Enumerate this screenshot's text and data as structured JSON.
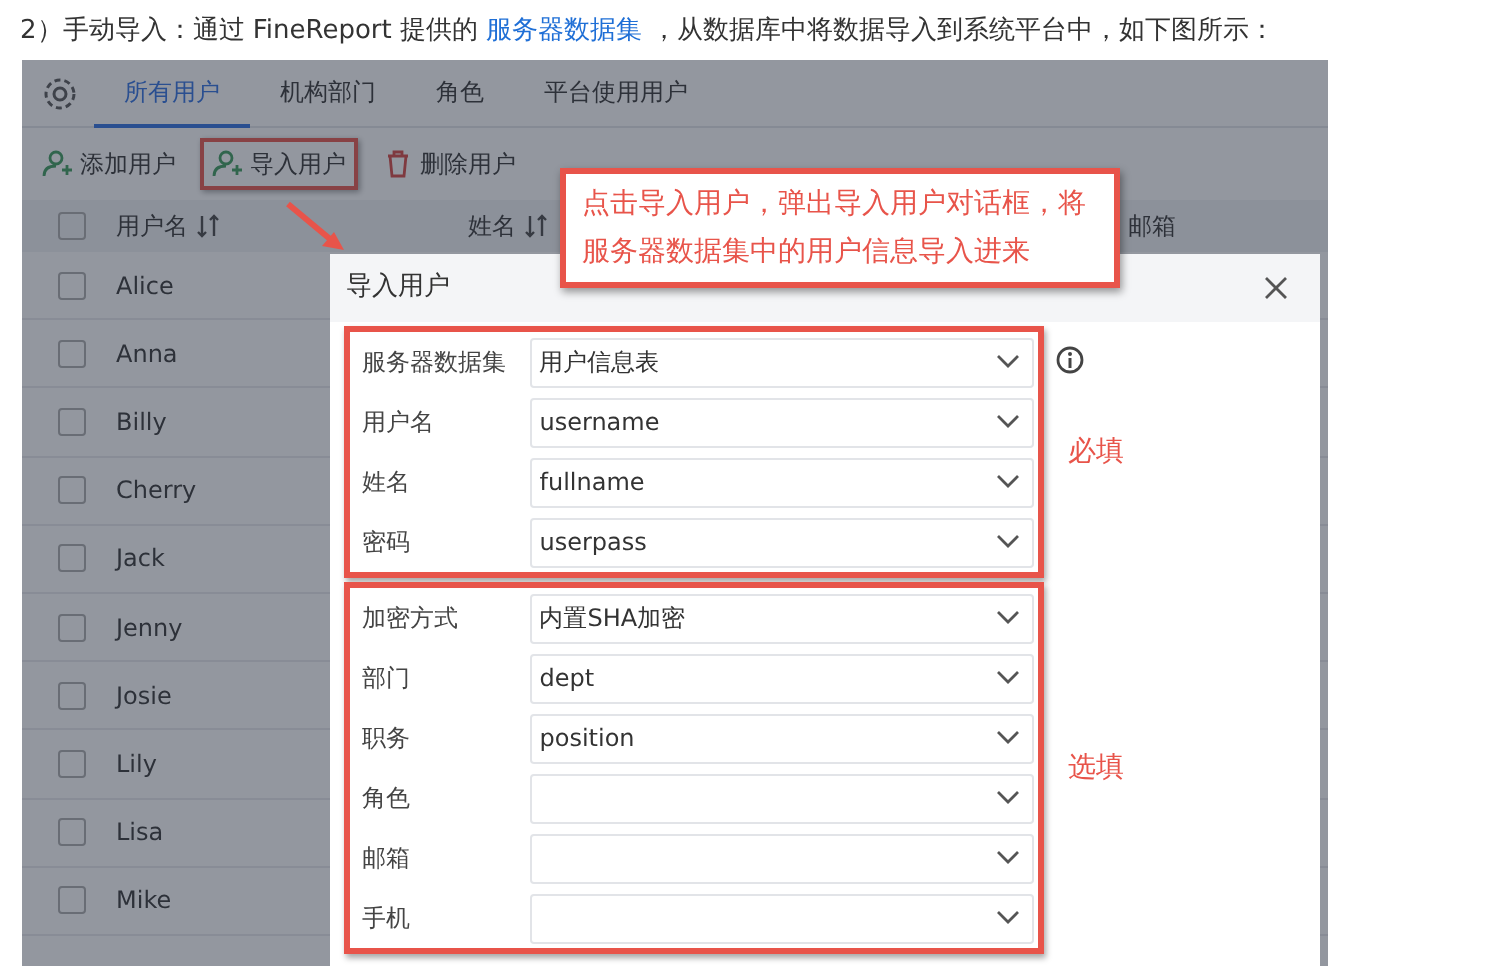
{
  "intro": {
    "text": "2）手动导入：通过 FineReport 提供的 ",
    "link": "服务器数据集",
    "text_after": " ，从数据库中将数据导入到系统平台中，如下图所示："
  },
  "app": {
    "tabs": [
      {
        "label": "所有用户",
        "selected": true
      },
      {
        "label": "机构部门",
        "selected": false
      },
      {
        "label": "角色",
        "selected": false
      },
      {
        "label": "平台使用用户",
        "selected": false
      }
    ],
    "toolbar": [
      {
        "label": "添加用户",
        "kind": "add",
        "annotated": false
      },
      {
        "label": "导入用户",
        "kind": "import",
        "annotated": true
      },
      {
        "label": "删除用户",
        "kind": "delete",
        "annotated": false
      }
    ],
    "table": {
      "header_checked": false,
      "columns": [
        "用户名",
        "姓名",
        "邮箱"
      ],
      "rows": [
        {
          "name": "Alice",
          "checked": false
        },
        {
          "name": "Anna",
          "checked": false
        },
        {
          "name": "Billy",
          "checked": false
        },
        {
          "name": "Cherry",
          "checked": false
        },
        {
          "name": "Jack",
          "checked": false
        },
        {
          "name": "Jenny",
          "checked": false
        },
        {
          "name": "Josie",
          "checked": false
        },
        {
          "name": "Lily",
          "checked": false
        },
        {
          "name": "Lisa",
          "checked": false
        },
        {
          "name": "Mike",
          "checked": false
        }
      ]
    }
  },
  "dialog": {
    "title": "导入用户",
    "groups": [
      {
        "note": "必填",
        "fields": [
          {
            "label": "服务器数据集",
            "value": "用户信息表"
          },
          {
            "label": "用户名",
            "value": "username"
          },
          {
            "label": "姓名",
            "value": "fullname"
          },
          {
            "label": "密码",
            "value": "userpass"
          }
        ]
      },
      {
        "note": "选填",
        "fields": [
          {
            "label": "加密方式",
            "value": "内置SHA加密"
          },
          {
            "label": "部门",
            "value": "dept"
          },
          {
            "label": "职务",
            "value": "position"
          },
          {
            "label": "角色"
          },
          {
            "label": "邮箱"
          },
          {
            "label": "手机"
          }
        ]
      }
    ]
  },
  "callout": {
    "lines": [
      "点击导入用户，弹出导入用户对话框，将",
      "服务器数据集中的用户信息导入进来"
    ]
  }
}
